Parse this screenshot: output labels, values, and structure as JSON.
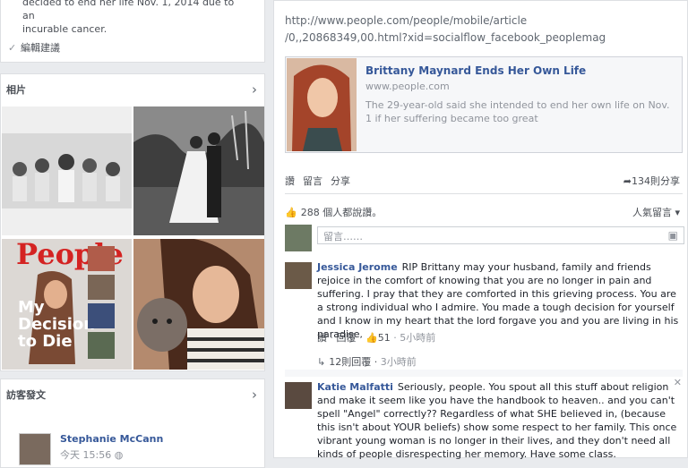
{
  "left": {
    "intro_lines": [
      "decided to end her life Nov. 1, 2014 due to an",
      "incurable cancer."
    ],
    "edit_label": "編輯建議",
    "photos_title": "相片",
    "posts_title": "訪客發文",
    "visitor": {
      "name": "Stephanie McCann",
      "time": "今天 15:56"
    },
    "photo3_text": {
      "brand": "People",
      "headline_1": "My",
      "headline_2": "Decision",
      "headline_3": "to Die"
    }
  },
  "post": {
    "url_line1": "http://www.people.com/people/mobile/article",
    "url_line2": "/0,,20868349,00.html?xid=socialflow_facebook_peoplemag",
    "share": {
      "title": "Brittany Maynard Ends Her Own Life",
      "domain": "www.people.com",
      "description": "The 29-year-old said she intended to end her own life on Nov. 1 if her suffering became too great"
    },
    "actions": {
      "like": "讚",
      "comment": "留言",
      "share": "分享"
    },
    "shares_count": "134則分享",
    "likes_text": "288 個人都說讚。",
    "sort_label": "人氣留言",
    "compose_placeholder": "留言……"
  },
  "comments": [
    {
      "author": "Jessica Jerome",
      "text": "RIP Brittany may your husband, family and friends rejoice in the comfort of knowing that you are no longer in pain and suffering. I pray that they are comforted in this grieving process. You are a strong individual who I admire. You made a tough decision for yourself and I know in my heart that the lord forgave you and you are living in his paradise.",
      "like": "讚",
      "reply": "回覆",
      "likes": "51",
      "time": "5小時前"
    },
    {
      "author": "Katie Malfatti",
      "text": "Seriously, people. You spout all this stuff about religion and make it seem like you have the handbook to heaven.. and you can't spell \"Angel\" correctly?? Regardless of what SHE believed in, (because this isn't about YOUR beliefs) show some respect to her family. This once vibrant young woman is no longer in their lives, and they don't need all kinds of people disrespecting her memory. Have some class.",
      "like": "",
      "reply": "",
      "likes": "",
      "time": ""
    }
  ],
  "replies": {
    "count": "12則回覆",
    "time": "3小時前"
  },
  "colors": {
    "link": "#365899",
    "bg": "#e9ebee",
    "muted": "#90949c"
  }
}
